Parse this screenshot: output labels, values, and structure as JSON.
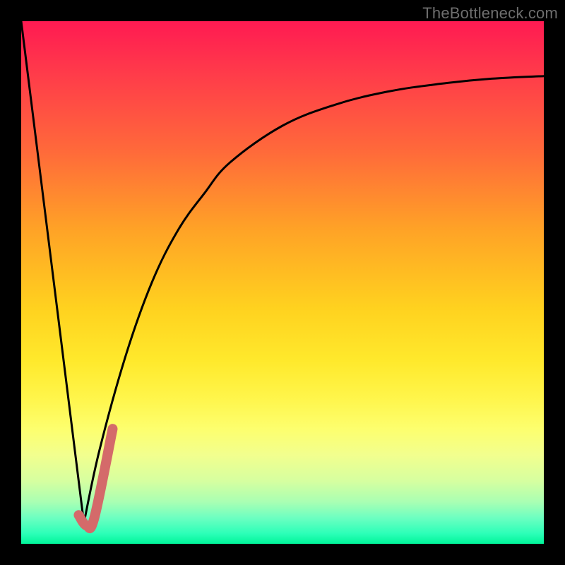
{
  "watermark": "TheBottleneck.com",
  "colors": {
    "curve_black": "#000000",
    "highlight": "#d46a6a"
  },
  "chart_data": {
    "type": "line",
    "title": "",
    "xlabel": "",
    "ylabel": "",
    "xlim": [
      0,
      100
    ],
    "ylim": [
      0,
      100
    ],
    "grid": false,
    "legend": false,
    "series": [
      {
        "name": "left-falling-line",
        "stroke": "#000000",
        "x": [
          0,
          12
        ],
        "y": [
          100,
          4
        ]
      },
      {
        "name": "right-rising-curve",
        "stroke": "#000000",
        "x": [
          12,
          15,
          20,
          25,
          30,
          35,
          40,
          50,
          60,
          70,
          80,
          90,
          100
        ],
        "y": [
          4,
          18,
          36,
          50,
          60,
          67,
          73,
          80,
          84,
          86.5,
          88,
          89,
          89.5
        ]
      },
      {
        "name": "highlight-j-stroke",
        "stroke": "#d46a6a",
        "x": [
          11,
          12.5,
          14,
          17.5
        ],
        "y": [
          5.5,
          3.5,
          5,
          22
        ]
      }
    ]
  }
}
